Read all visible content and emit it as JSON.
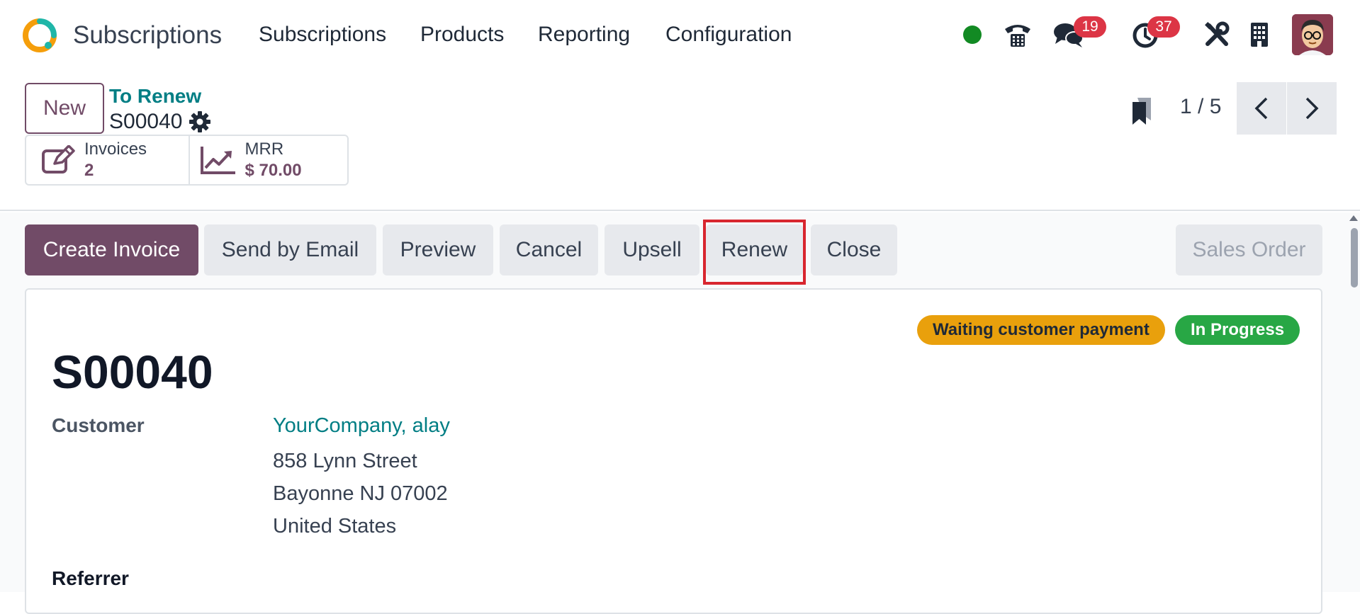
{
  "navbar": {
    "app_name": "Subscriptions",
    "menu": [
      "Subscriptions",
      "Products",
      "Reporting",
      "Configuration"
    ],
    "status_color": "#128a23",
    "messages_count": "19",
    "activities_count": "37",
    "icons": [
      "phone-icon",
      "chat-icon",
      "clock-icon",
      "tools-icon",
      "building-icon"
    ]
  },
  "control_panel": {
    "new_label": "New",
    "breadcrumb": "To Renew",
    "record_name": "S00040",
    "smart_buttons": [
      {
        "label": "Invoices",
        "value": "2"
      },
      {
        "label": "MRR",
        "value": "$ 70.00"
      }
    ],
    "pager": "1 / 5"
  },
  "status_bar": {
    "buttons": [
      "Create Invoice",
      "Send by Email",
      "Preview",
      "Cancel",
      "Upsell",
      "Renew",
      "Close"
    ],
    "sales_order_label": "Sales Order",
    "highlighted": "Renew"
  },
  "sheet": {
    "badges": [
      "Waiting customer payment",
      "In Progress"
    ],
    "title": "S00040",
    "customer_label": "Customer",
    "customer_name": "YourCompany, alay",
    "address": [
      "858 Lynn Street",
      "Bayonne NJ 07002",
      "United States"
    ],
    "referrer_label": "Referrer"
  },
  "colors": {
    "brand": "#714b67",
    "link": "#017e84",
    "badge_warning": "#e9a00c",
    "badge_success": "#28a745",
    "highlight": "#d8262f"
  }
}
